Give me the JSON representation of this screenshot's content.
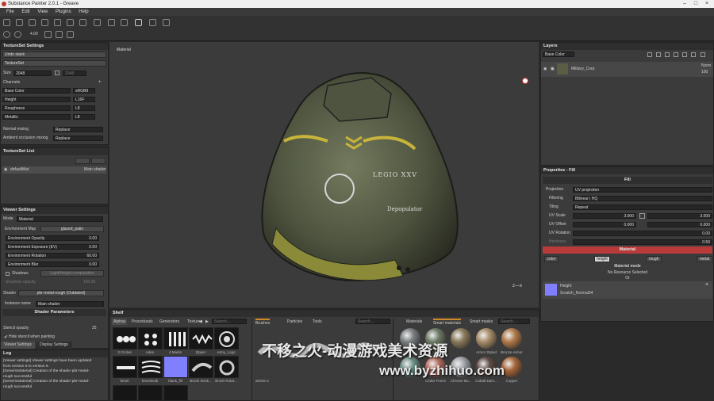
{
  "window": {
    "title": "Substance Painter 2.0.1 - Greave"
  },
  "menu": [
    "File",
    "Edit",
    "View",
    "Plugins",
    "Help"
  ],
  "toolbar": {
    "brush_size": "4.00"
  },
  "textureset_settings": {
    "title": "TextureSet Settings",
    "undo_stack": "Undo stack",
    "textureset": "TextureSet",
    "size_label": "Size",
    "size_value": "2048",
    "size_value2": "2048",
    "channels_label": "Channels",
    "channels": [
      {
        "name": "Base Color",
        "format": "sRGB8"
      },
      {
        "name": "Height",
        "format": "L16F"
      },
      {
        "name": "Roughness",
        "format": "L8"
      },
      {
        "name": "Metallic",
        "format": "L8"
      }
    ],
    "normal_mixing_label": "Normal mixing",
    "normal_mixing_value": "Replace",
    "ao_mixing_label": "Ambient occlusion mixing",
    "ao_mixing_value": "Replace"
  },
  "textureset_list": {
    "title": "TextureSet List",
    "item_name": "defaultMat",
    "item_shader": "Main shader"
  },
  "viewer_settings": {
    "title": "Viewer Settings",
    "mode_label": "Mode",
    "mode_value": "Material",
    "env_map_label": "Environment Map",
    "env_map_value": "glazed_patio",
    "sliders": [
      {
        "label": "Environment Opacity",
        "value": "0.00"
      },
      {
        "label": "Environment Exposure (EV)",
        "value": "0.00"
      },
      {
        "label": "Environment Rotation",
        "value": "60.00"
      },
      {
        "label": "Environment Blur",
        "value": "0.00"
      }
    ],
    "shadows_label": "Shadows",
    "shadows_value": "Light/Height computation",
    "shadows_opacity_label": "Shadows opacity",
    "shadows_opacity_value": "100.00",
    "shader_label": "Shader",
    "shader_value": "pbr-metal-rough (Outdated)",
    "instance_label": "Instance name",
    "instance_value": "Main shader",
    "shader_params": "Shader Parameters",
    "stencil_label": "Stencil opacity",
    "stencil_value": "25",
    "hide_stencil": "Hide stencil when painting",
    "tab1": "Viewer Settings",
    "tab2": "Display Settings"
  },
  "log": {
    "title": "Log",
    "lines": [
      "[Viewer settings] Viewer settings have been updated",
      "from version 5 to version 6.",
      "[GenericMaterial] Creation of the shader pbr-metal-",
      "rough successful",
      "[GenericMaterial] Creation of the shader pbr-metal-",
      "rough successful"
    ]
  },
  "viewport": {
    "label": "Material",
    "shield_text1": "LEGIO XXV",
    "shield_text2": "Depopulator"
  },
  "layers": {
    "title": "Layers",
    "blend_mode": "Base Color",
    "layer_name": "Military_Corp",
    "blend": "Norm",
    "opacity": "100"
  },
  "properties": {
    "title": "Properties - Fill",
    "fill_header": "Fill",
    "rows": [
      {
        "label": "Projection",
        "value": "UV projection"
      },
      {
        "label": "Filtering",
        "value": "Bilinear | HQ"
      },
      {
        "label": "Tiling",
        "value": "Repeat"
      }
    ],
    "uv_scale_label": "UV Scale",
    "uv_scale_a": "3.000",
    "uv_scale_b": "3.000",
    "uv_offset_label": "UV Offset",
    "uv_offset_a": "0.000",
    "uv_offset_b": "0.000",
    "uv_rotation_label": "UV Rotation",
    "uv_rotation_value": "0.00",
    "hardness_label": "Hardness",
    "hardness_value": "0.50",
    "material_header": "Material",
    "channel_buttons": [
      "color",
      "height",
      "rough",
      "metal"
    ],
    "material_mode_label": "Material mode",
    "material_mode_value": "No Resource Selected",
    "or_label": "Or",
    "height_title": "Height",
    "height_resource": "Scratch_Normal34"
  },
  "shelf": {
    "title": "Shelf",
    "tabs": [
      "Alphas",
      "Procedurals",
      "Generators",
      "Textures"
    ],
    "search_placeholder": "Search...",
    "alphas": [
      {
        "label": "3 Circles"
      },
      {
        "label": "Ades"
      },
      {
        "label": "4 Marks"
      },
      {
        "label": "Zipper"
      },
      {
        "label": "Army_Logo"
      },
      {
        "label": "bevel"
      },
      {
        "label": "bevelmulti"
      },
      {
        "label": "blank_fill"
      },
      {
        "label": "Brush Strok..."
      },
      {
        "label": "Brush Rotat..."
      }
    ],
    "brush_tabs": [
      "Brushes",
      "Particles",
      "Tools"
    ],
    "brush_label": "artistic 6",
    "material_tabs": [
      "Materials",
      "Smart materials",
      "Smart masks"
    ],
    "materials": [
      {
        "label": "",
        "color": "#7a7f80"
      },
      {
        "label": "",
        "color": "#6e7a66"
      },
      {
        "label": "",
        "color": "#8a7a5c"
      },
      {
        "label": "Armor Styled",
        "color": "#a88d6a"
      },
      {
        "label": "Bronze Armor",
        "color": "#b07a4a"
      },
      {
        "label": "",
        "color": "#6a8e86"
      },
      {
        "label": "Cedar Fence",
        "color": "#b26a5e"
      },
      {
        "label": "Chrome Bu...",
        "color": "#9ea3a8"
      },
      {
        "label": "Cobalt Dam...",
        "color": "#5d4a44"
      },
      {
        "label": "Copper",
        "color": "#a7663a"
      }
    ]
  },
  "watermark": {
    "line1": "不移之火-动漫游戏美术资源",
    "line2": "www.byzhihuo.com"
  },
  "colors": {
    "accent_red": "#b83a3a",
    "swatch": "#7f7fff"
  }
}
